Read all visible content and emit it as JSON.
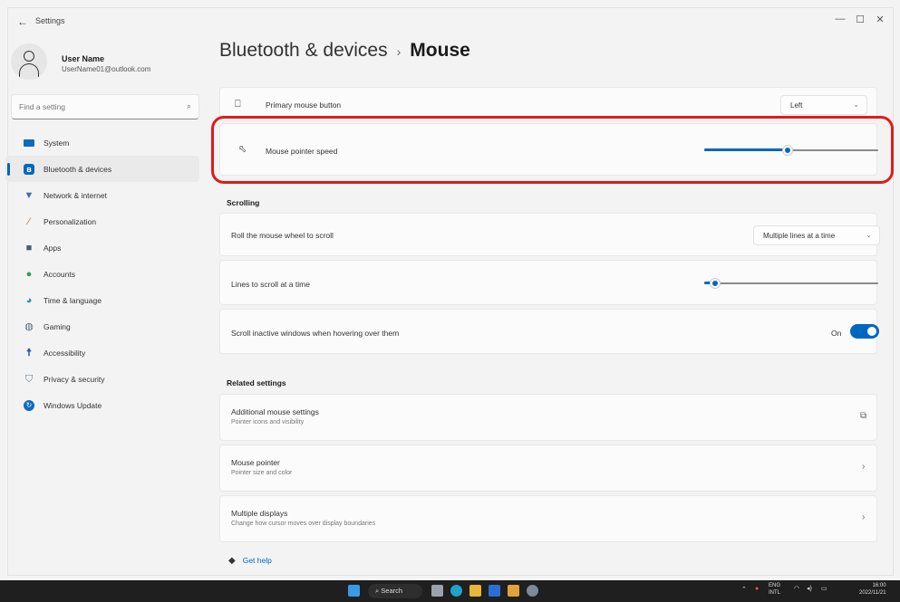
{
  "window": {
    "back": "←",
    "title": "Settings",
    "minimize": "—",
    "maximize": "☐",
    "close": "✕"
  },
  "profile": {
    "name": "User Name",
    "email": "UserName01@outlook.com"
  },
  "search": {
    "placeholder": "Find a setting",
    "icon": "search-icon"
  },
  "nav": {
    "items": [
      {
        "label": "System",
        "icon": "system-icon",
        "color": "#0f6cbd"
      },
      {
        "label": "Bluetooth & devices",
        "icon": "bluetooth-icon",
        "color": "#0067c0",
        "active": true
      },
      {
        "label": "Network & internet",
        "icon": "wifi-icon",
        "color": "#3d6fb5"
      },
      {
        "label": "Personalization",
        "icon": "brush-icon",
        "color": "#b36b2a"
      },
      {
        "label": "Apps",
        "icon": "apps-icon",
        "color": "#4a5a7a"
      },
      {
        "label": "Accounts",
        "icon": "accounts-icon",
        "color": "#2aa06a"
      },
      {
        "label": "Time & language",
        "icon": "time-language-icon",
        "color": "#2a8ac7"
      },
      {
        "label": "Gaming",
        "icon": "gaming-icon",
        "color": "#5a6a7a"
      },
      {
        "label": "Accessibility",
        "icon": "accessibility-icon",
        "color": "#1a4fa8"
      },
      {
        "label": "Privacy & security",
        "icon": "shield-icon",
        "color": "#6a7a8a"
      },
      {
        "label": "Windows Update",
        "icon": "update-icon",
        "color": "#0f6cbd"
      }
    ]
  },
  "header": {
    "parent": "Bluetooth & devices",
    "separator": "›",
    "current": "Mouse"
  },
  "settings": {
    "primary_button": {
      "label": "Primary mouse button",
      "value": "Left",
      "icon": "mouse-icon"
    },
    "pointer_speed": {
      "label": "Mouse pointer speed",
      "icon": "pointer-icon",
      "value_pct": 48
    }
  },
  "scrolling": {
    "title": "Scrolling",
    "roll": {
      "label": "Roll the mouse wheel to scroll",
      "value": "Multiple lines at a time"
    },
    "lines": {
      "label": "Lines to scroll at a time",
      "value_pct": 6
    },
    "inactive": {
      "label": "Scroll inactive windows when hovering over them",
      "state": "On"
    }
  },
  "related": {
    "title": "Related settings",
    "items": [
      {
        "label": "Additional mouse settings",
        "sub": "Pointer icons and visibility",
        "icon": "open-external-icon"
      },
      {
        "label": "Mouse pointer",
        "sub": "Pointer size and color",
        "icon": "chevron-right-icon"
      },
      {
        "label": "Multiple displays",
        "sub": "Change how cursor moves over display boundaries",
        "icon": "chevron-right-icon"
      }
    ]
  },
  "help": {
    "label": "Get help"
  },
  "taskbar": {
    "search_label": "Search",
    "lang_top": "ENG",
    "lang_bottom": "INTL",
    "time": "16:00",
    "date": "2022/11/21"
  },
  "colors": {
    "accent": "#0067c0",
    "highlight": "#e01b1b"
  }
}
